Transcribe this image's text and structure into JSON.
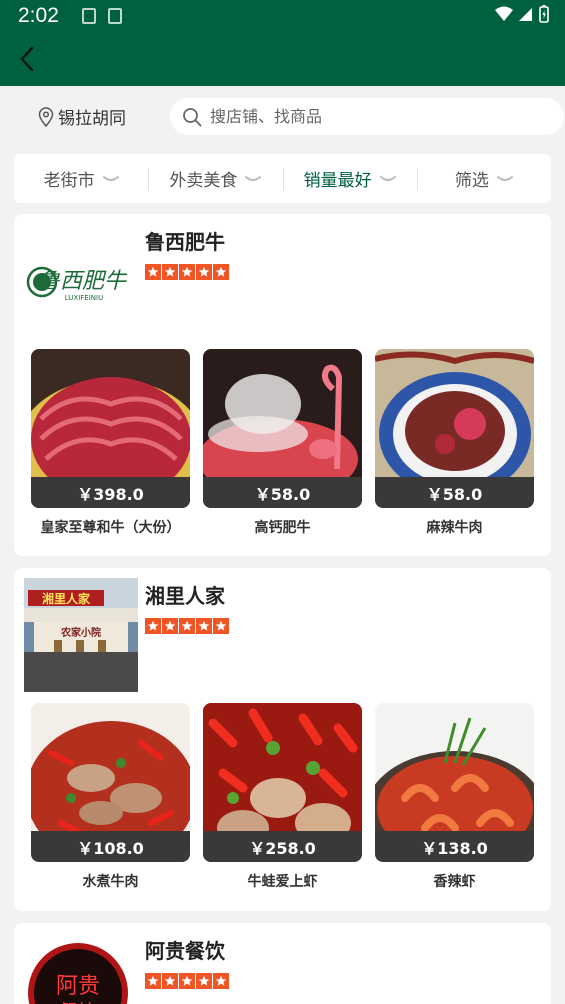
{
  "status_bar": {
    "time": "2:02"
  },
  "header": {
    "location": "锡拉胡同",
    "search_placeholder": "搜店铺、找商品"
  },
  "filters": [
    {
      "label": "老街市",
      "active": false
    },
    {
      "label": "外卖美食",
      "active": false
    },
    {
      "label": "销量最好",
      "active": true
    },
    {
      "label": "筛选",
      "active": false
    }
  ],
  "colors": {
    "brand": "#00613e",
    "star": "#f05523",
    "price_bg": "#3b3838"
  },
  "shops": [
    {
      "name": "鲁西肥牛",
      "rating": 5,
      "logo_text": "鲁西肥牛",
      "logo_sub": "LUXIFEINIU",
      "items": [
        {
          "name": "皇家至尊和牛（大份）",
          "price": "￥398.0"
        },
        {
          "name": "高钙肥牛",
          "price": "￥58.0"
        },
        {
          "name": "麻辣牛肉",
          "price": "￥58.0"
        }
      ]
    },
    {
      "name": "湘里人家",
      "rating": 5,
      "logo_text": "湘里人家",
      "logo_sub": "农家小院",
      "items": [
        {
          "name": "水煮牛肉",
          "price": "￥108.0"
        },
        {
          "name": "牛蛙爱上虾",
          "price": "￥258.0"
        },
        {
          "name": "香辣虾",
          "price": "￥138.0"
        }
      ]
    },
    {
      "name": "阿贵餐饮",
      "rating": 5,
      "logo_text": "阿贵",
      "logo_sub": "餐饮",
      "items": []
    }
  ]
}
